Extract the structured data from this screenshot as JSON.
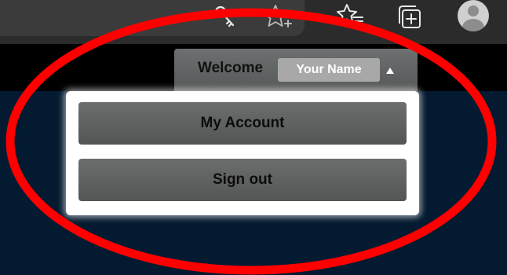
{
  "browser": {
    "toolbar_icons": [
      "key-icon",
      "favorite-star-add-icon",
      "favorites-icon",
      "collections-icon",
      "profile-avatar-icon"
    ]
  },
  "user_menu": {
    "welcome_label": "Welcome",
    "user_name": "Your Name",
    "items": [
      {
        "label": "My Account"
      },
      {
        "label": "Sign out"
      }
    ]
  },
  "colors": {
    "page_background": "#041a30",
    "menu_button": "#616363",
    "annotation": "#ff0000"
  }
}
